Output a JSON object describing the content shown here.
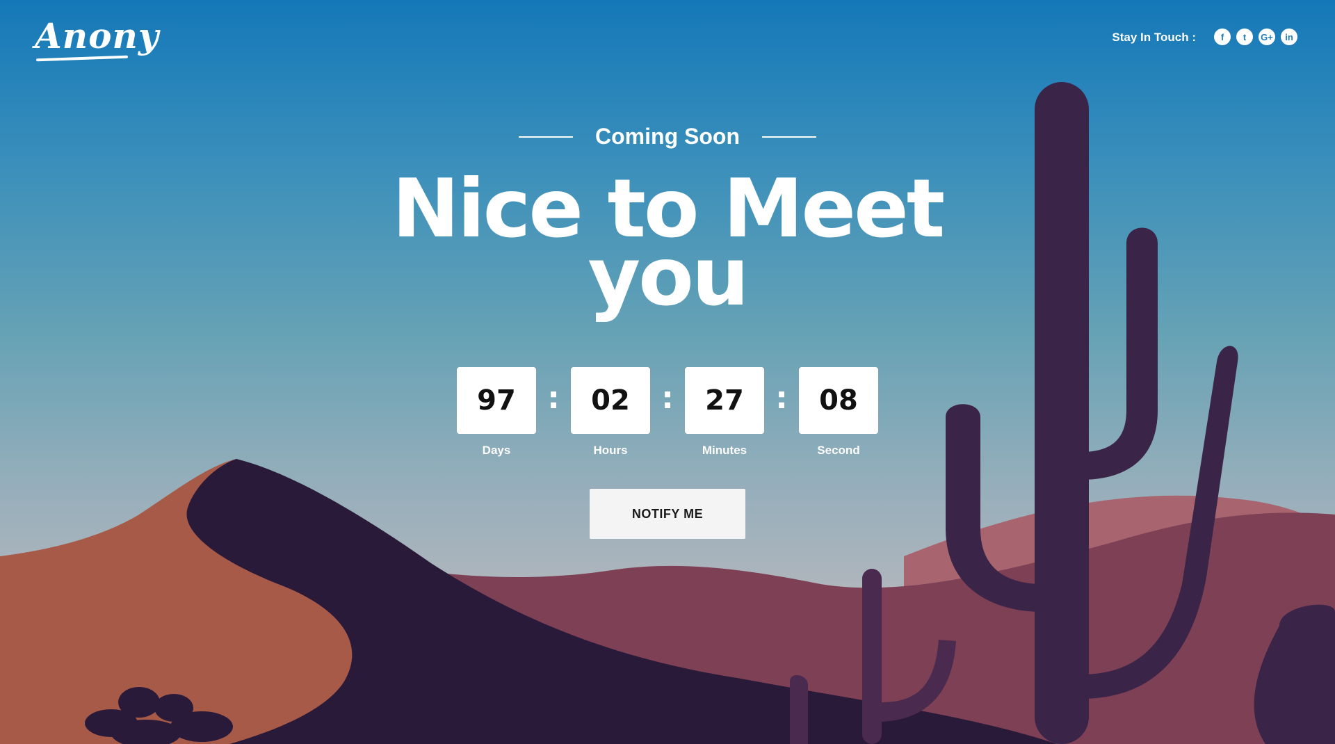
{
  "brand": {
    "logo_text": "Anony"
  },
  "header": {
    "stay_in_touch": "Stay In Touch :",
    "socials": [
      {
        "name": "facebook-icon",
        "glyph": "f"
      },
      {
        "name": "twitter-icon",
        "glyph": "t"
      },
      {
        "name": "google-plus-icon",
        "glyph": "G+"
      },
      {
        "name": "linkedin-icon",
        "glyph": "in"
      }
    ]
  },
  "hero": {
    "eyebrow": "Coming Soon",
    "headline_line1": "Nice to Meet",
    "headline_line2": "you"
  },
  "countdown": {
    "days": {
      "value": "97",
      "label": "Days"
    },
    "hours": {
      "value": "02",
      "label": "Hours"
    },
    "minutes": {
      "value": "27",
      "label": "Minutes"
    },
    "seconds": {
      "value": "08",
      "label": "Second"
    },
    "separator": ":"
  },
  "cta": {
    "notify_label": "NOTIFY ME"
  },
  "colors": {
    "sky_top": "#1478b8",
    "sky_bottom": "#b1b6bc",
    "dune_orange": "#a85a49",
    "dune_dark": "#2a1a3a",
    "dune_mauve": "#7d4055",
    "cactus": "#3a2448"
  }
}
